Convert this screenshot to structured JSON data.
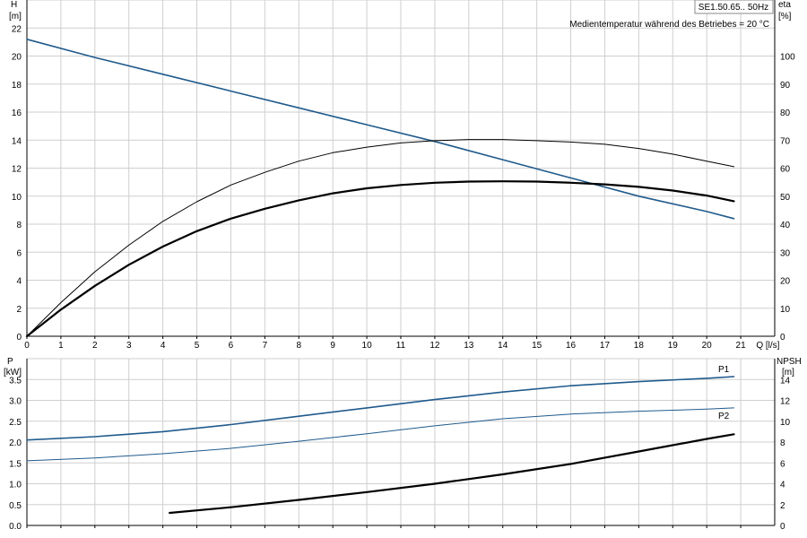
{
  "info": {
    "model": "SE1.50.65.. 50Hz",
    "note": "Medientemperatur während des Betriebes = 20 °C"
  },
  "colors": {
    "grid": "#cfcfcf",
    "axis": "#000000",
    "blue": "#1f5a8c",
    "black": "#000000"
  },
  "chart_data": [
    {
      "type": "line",
      "x_axis": {
        "label": "Q [l/s]",
        "range": [
          0,
          22
        ],
        "ticks": [
          0,
          1,
          2,
          3,
          4,
          5,
          6,
          7,
          8,
          9,
          10,
          11,
          12,
          13,
          14,
          15,
          16,
          17,
          18,
          19,
          20,
          21
        ]
      },
      "y_left": {
        "label": "H",
        "unit": "[m]",
        "range": [
          0,
          24
        ],
        "ticks": [
          0,
          2,
          4,
          6,
          8,
          10,
          12,
          14,
          16,
          18,
          20,
          22
        ]
      },
      "y_right": {
        "label": "eta",
        "unit": "[%]",
        "range": [
          0,
          120
        ],
        "ticks": [
          0,
          10,
          20,
          30,
          40,
          50,
          60,
          70,
          80,
          90,
          100
        ]
      },
      "grid": true,
      "series": [
        {
          "name": "H",
          "axis": "left",
          "color": "#1f5a8c",
          "width": 1.6,
          "x": [
            0,
            2,
            4,
            6,
            8,
            10,
            12,
            14,
            16,
            18,
            20,
            20.8
          ],
          "y": [
            21.2,
            19.9,
            18.7,
            17.5,
            16.3,
            15.1,
            13.9,
            12.6,
            11.3,
            10.0,
            8.9,
            8.4
          ]
        },
        {
          "name": "eta",
          "axis": "right",
          "color": "#000000",
          "width": 1,
          "x": [
            0,
            1,
            2,
            3,
            4,
            5,
            6,
            7,
            8,
            9,
            10,
            11,
            12,
            13,
            14,
            15,
            16,
            17,
            18,
            19,
            20,
            20.8
          ],
          "y": [
            0,
            12,
            23,
            32.5,
            41,
            48,
            54,
            58.5,
            62.5,
            65.5,
            67.5,
            69,
            69.8,
            70.2,
            70.2,
            69.8,
            69.3,
            68.5,
            67,
            65,
            62.5,
            60.5
          ]
        },
        {
          "name": "eta-bold",
          "axis": "right",
          "color": "#000000",
          "width": 2.2,
          "x": [
            0,
            1,
            2,
            3,
            4,
            5,
            6,
            7,
            8,
            9,
            10,
            11,
            12,
            13,
            14,
            15,
            16,
            17,
            18,
            19,
            20,
            20.8
          ],
          "y": [
            0,
            9.5,
            18,
            25.5,
            32,
            37.5,
            42,
            45.5,
            48.5,
            51,
            52.8,
            54,
            54.8,
            55.2,
            55.3,
            55.2,
            54.8,
            54.2,
            53.3,
            52,
            50.2,
            48.2
          ]
        }
      ]
    },
    {
      "type": "line",
      "x_axis": {
        "range": [
          0,
          22
        ]
      },
      "y_left": {
        "label": "P",
        "unit": "[kW]",
        "range": [
          0,
          4.0
        ],
        "ticks": [
          0.0,
          0.5,
          1.0,
          1.5,
          2.0,
          2.5,
          3.0,
          3.5
        ]
      },
      "y_right": {
        "label": "NPSH",
        "unit": "[m]",
        "range": [
          0,
          16
        ],
        "ticks": [
          0,
          2,
          4,
          6,
          8,
          10,
          12,
          14
        ]
      },
      "grid": true,
      "series": [
        {
          "name": "P1",
          "axis": "left",
          "color": "#1f5a8c",
          "width": 1.6,
          "x": [
            0,
            2,
            4,
            6,
            8,
            10,
            12,
            14,
            16,
            18,
            20,
            20.8
          ],
          "y": [
            2.05,
            2.13,
            2.25,
            2.42,
            2.62,
            2.82,
            3.02,
            3.2,
            3.35,
            3.45,
            3.53,
            3.57
          ]
        },
        {
          "name": "P2",
          "axis": "left",
          "color": "#1f5a8c",
          "width": 1,
          "x": [
            0,
            2,
            4,
            6,
            8,
            10,
            12,
            14,
            16,
            18,
            20,
            20.8
          ],
          "y": [
            1.55,
            1.62,
            1.72,
            1.85,
            2.02,
            2.2,
            2.39,
            2.56,
            2.67,
            2.74,
            2.79,
            2.82
          ]
        },
        {
          "name": "NPSH",
          "axis": "right",
          "color": "#000000",
          "width": 2.2,
          "x": [
            4.2,
            6,
            8,
            10,
            12,
            14,
            16,
            18,
            20,
            20.8
          ],
          "y": [
            1.2,
            1.75,
            2.45,
            3.2,
            4.0,
            4.9,
            5.9,
            7.1,
            8.3,
            8.75
          ]
        }
      ]
    }
  ]
}
